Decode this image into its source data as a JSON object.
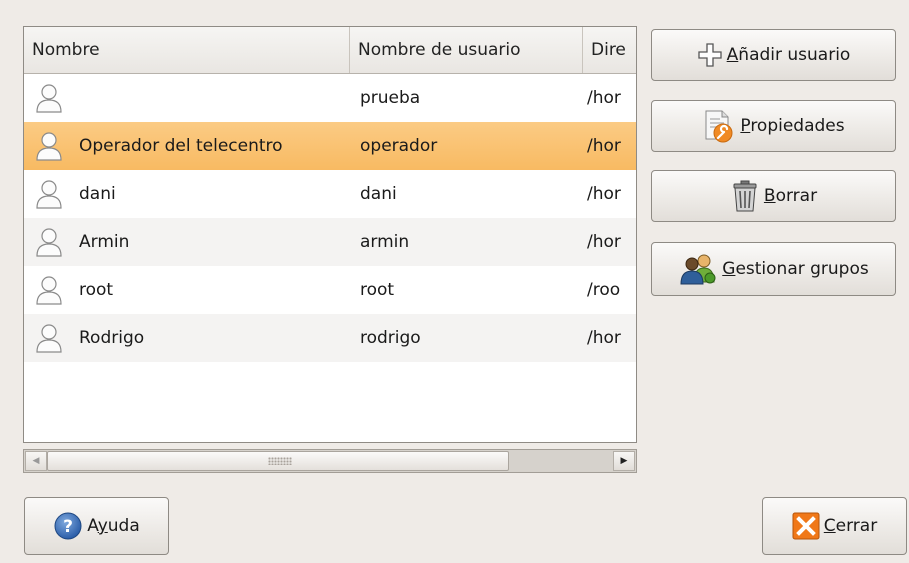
{
  "columns": {
    "name": "Nombre",
    "username": "Nombre de usuario",
    "directory": "Dire"
  },
  "users": [
    {
      "name": "",
      "username": "prueba",
      "directory": "/hor"
    },
    {
      "name": "Operador del telecentro",
      "username": "operador",
      "directory": "/hor"
    },
    {
      "name": "dani",
      "username": "dani",
      "directory": "/hor"
    },
    {
      "name": "Armin",
      "username": "armin",
      "directory": "/hor"
    },
    {
      "name": "root",
      "username": "root",
      "directory": "/roo"
    },
    {
      "name": "Rodrigo",
      "username": "rodrigo",
      "directory": "/hor"
    }
  ],
  "selected_row_index": 1,
  "icons": {
    "user": "user-silhouette-icon",
    "add": "plus-icon",
    "properties": "properties-wrench-icon",
    "delete": "trash-can-icon",
    "groups": "group-users-icon",
    "help": "help-question-icon",
    "close": "close-x-icon"
  },
  "buttons": {
    "add_user": {
      "mnemonic": "A",
      "rest": "ñadir usuario"
    },
    "properties": {
      "mnemonic": "P",
      "rest": "ropiedades"
    },
    "delete": {
      "mnemonic": "B",
      "rest": "orrar"
    },
    "manage_groups": {
      "mnemonic": "G",
      "rest": "estionar grupos"
    },
    "help": {
      "before": "A",
      "mnemonic": "y",
      "rest": "uda"
    },
    "close": {
      "mnemonic": "C",
      "rest": "errar"
    }
  },
  "colors": {
    "selection": "#f8ba62",
    "window_bg": "#efebe7"
  }
}
